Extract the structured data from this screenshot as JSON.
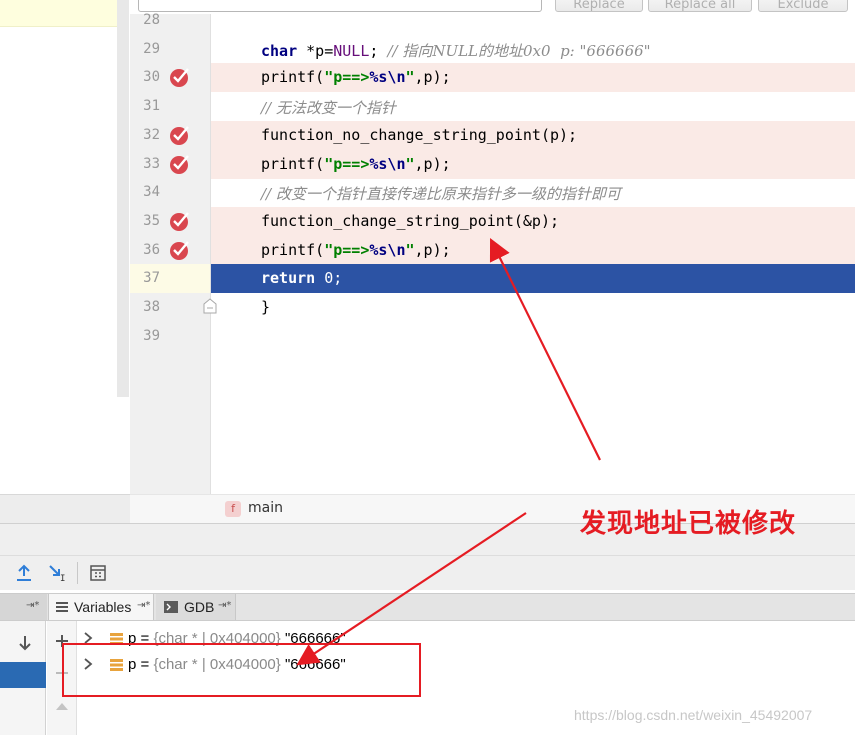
{
  "top_bar": {
    "replace_label": "Replace",
    "replace_all_label": "Replace all",
    "exclude_label": "Exclude"
  },
  "editor": {
    "lines": [
      {
        "num": "28",
        "kind": "plain",
        "breakpoint": false
      },
      {
        "num": "29",
        "kind": "decl",
        "breakpoint": false,
        "t1": "char",
        "t2": " *p=",
        "t3": "NULL",
        "t4": "; ",
        "t5": "// 指向NULL的地址0x0  p: \"666666\""
      },
      {
        "num": "30",
        "kind": "printf",
        "breakpoint": true,
        "t1": "printf(",
        "t2": "\"p==>",
        "t3": "%s\\n",
        "t4": "\"",
        "t5": ",p);"
      },
      {
        "num": "31",
        "kind": "comment",
        "breakpoint": false,
        "t1": "// 无法改变一个指针"
      },
      {
        "num": "32",
        "kind": "plain",
        "breakpoint": true,
        "t1": "function_no_change_string_point(p);"
      },
      {
        "num": "33",
        "kind": "printf",
        "breakpoint": true,
        "t1": "printf(",
        "t2": "\"p==>",
        "t3": "%s\\n",
        "t4": "\"",
        "t5": ",p);"
      },
      {
        "num": "34",
        "kind": "comment",
        "breakpoint": false,
        "t1": "// 改变一个指针直接传递比原来指针多一级的指针即可"
      },
      {
        "num": "35",
        "kind": "plain",
        "breakpoint": true,
        "t1": "function_change_string_point(&p);"
      },
      {
        "num": "36",
        "kind": "printf",
        "breakpoint": true,
        "t1": "printf(",
        "t2": "\"p==>",
        "t3": "%s\\n",
        "t4": "\"",
        "t5": ",p);"
      },
      {
        "num": "37",
        "kind": "return",
        "breakpoint": false,
        "current": true,
        "t1": "return",
        "t2": " 0;"
      },
      {
        "num": "38",
        "kind": "plain",
        "breakpoint": false,
        "t1": "}"
      },
      {
        "num": "39",
        "kind": "plain",
        "breakpoint": false
      }
    ]
  },
  "breadcrumb": {
    "badge": "f",
    "text": "main"
  },
  "debug": {
    "tabs": {
      "variables_label": "Variables",
      "gdb_label": "GDB",
      "pin_glyph": "⇥*"
    },
    "variables": [
      {
        "name": "p",
        "eq": " = ",
        "type": "{char * | 0x404000}",
        "value": " \"666666\""
      },
      {
        "name": "p",
        "eq": " = ",
        "type": "{char * | 0x404000}",
        "value": " \"666666\""
      }
    ]
  },
  "annotation": {
    "text": "发现地址已被修改",
    "color": "#e51c23"
  },
  "watermark": "https://blog.csdn.net/weixin_45492007",
  "colors": {
    "breakpoint_line_bg": "#faeae6",
    "current_line_bg": "#2c53a4",
    "breakpoint_icon": "#d9474f",
    "keyword": "#000080",
    "string": "#008000",
    "comment": "#8c8c8c"
  }
}
